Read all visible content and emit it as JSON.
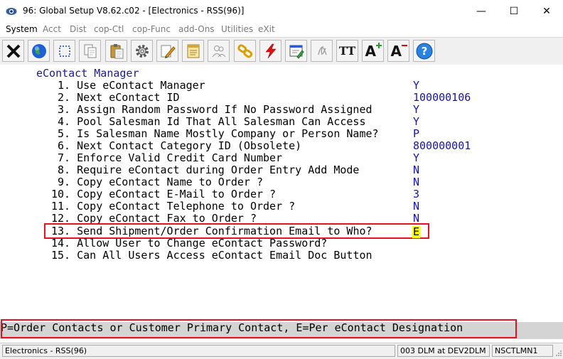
{
  "window": {
    "title": "96: Global Setup V8.62.c02 - [Electronics - RSS(96)]",
    "minimize_glyph": "—",
    "maximize_glyph": "☐",
    "close_glyph": "✕"
  },
  "menu": {
    "items": [
      "System",
      "Acct",
      "Dist",
      "cop-Ctl",
      "cop-Func",
      "add-Ons",
      "Utilities",
      "eXit"
    ]
  },
  "toolbar": {
    "icons": [
      "close-x-icon",
      "globe-icon",
      "select-box-icon",
      "copy-icon",
      "paste-icon",
      "settings-gear-icon",
      "edit-pencil-icon",
      "notepad-icon",
      "users-icon",
      "link-chain-icon",
      "lightning-icon",
      "window-edit-icon",
      "script-icon",
      "font-tt-icon",
      "font-increase-icon",
      "font-decrease-icon",
      "help-icon"
    ],
    "labels": {
      "font_tt": "TT",
      "font_a": "A",
      "help": "?"
    }
  },
  "screen": {
    "heading": "eContact Manager",
    "options": [
      {
        "label": "1. Use eContact Manager",
        "value": "Y"
      },
      {
        "label": "2. Next eContact ID",
        "value": "100000106"
      },
      {
        "label": "3. Assign Random Password If No Password Assigned",
        "value": "Y"
      },
      {
        "label": "4. Pool Salesman Id That All Salesman Can Access",
        "value": "Y"
      },
      {
        "label": "5. Is Salesman Name Mostly Company or Person Name?",
        "value": "P"
      },
      {
        "label": "6. Next Contact Category ID (Obsolete)",
        "value": "800000001"
      },
      {
        "label": "7. Enforce Valid Credit Card Number",
        "value": "Y"
      },
      {
        "label": "8. Require eContact during Order Entry Add Mode",
        "value": "N"
      },
      {
        "label": "9. Copy eContact Name to Order ?",
        "value": "N"
      },
      {
        "label": "10. Copy eContact E-Mail to Order ?",
        "value": "3"
      },
      {
        "label": "11. Copy eContact Telephone to Order ?",
        "value": "N"
      },
      {
        "label": "12. Copy eContact Fax to Order ?",
        "value": "N"
      },
      {
        "label": "13. Send Shipment/Order Confirmation Email to Who?",
        "value": "E"
      },
      {
        "label": "14. Allow User to Change eContact Password?",
        "value": ""
      },
      {
        "label": "15. Can All Users Access eContact Email Doc Button",
        "value": ""
      }
    ]
  },
  "hint": {
    "text": "P=Order Contacts or Customer Primary Contact, E=Per eContact Designation"
  },
  "status": {
    "company": "Electronics - RSS(96)",
    "session": "003 DLM at DEV2DLM",
    "terminal": "NSCTLMN1"
  },
  "colors": {
    "highlight_border": "#e81123",
    "value_text": "#1515b0",
    "cursor_bg": "#ffff00"
  }
}
